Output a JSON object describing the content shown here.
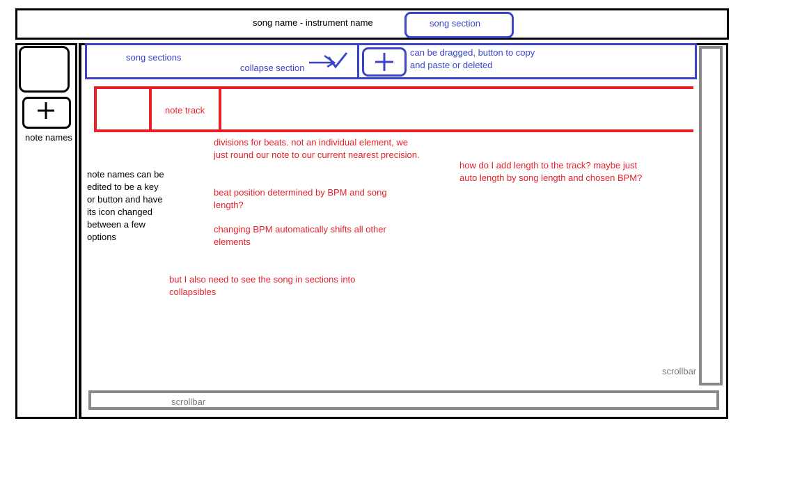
{
  "header": {
    "title": "song name - instrument name",
    "song_section_button": "song section"
  },
  "left_panel": {
    "label": "note names",
    "annotation": "note names can be edited to be a key or button and have its icon changed between a few options"
  },
  "sections_bar": {
    "label": "song sections",
    "collapse_label": "collapse section",
    "annotation": "can be dragged, button to copy and paste or deleted"
  },
  "track": {
    "label": "note track"
  },
  "notes": {
    "beats": "divisions for beats. not an individual element, we just round our note to our current nearest precision.",
    "bpm_position": "beat position determined by BPM and song length?",
    "bpm_shift": "changing BPM automatically shifts all other elements",
    "sections": "but I also need to see the song in sections into collapsibles",
    "length": "how do I add length to the track? maybe just auto length by song length and chosen BPM?"
  },
  "scrollbars": {
    "vertical_label": "scrollbar",
    "horizontal_label": "scrollbar"
  },
  "colors": {
    "blue": "#3a44c8",
    "red": "#e8202a",
    "gray": "#888888",
    "black": "#000000"
  },
  "icons": [
    "plus-icon",
    "collapse-arrow-icon"
  ]
}
